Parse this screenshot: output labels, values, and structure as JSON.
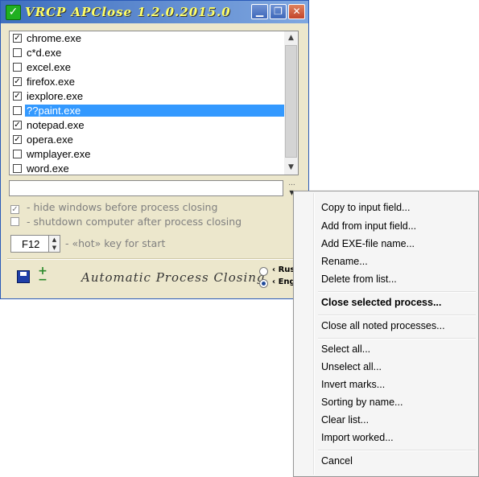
{
  "window": {
    "title": "VRCP APClose 1.2.0.2015.0",
    "buttons": {
      "minimize": "▁",
      "restore": "❐",
      "close": "✕"
    }
  },
  "process_list": [
    {
      "name": "chrome.exe",
      "checked": true,
      "selected": false
    },
    {
      "name": "c*d.exe",
      "checked": false,
      "selected": false
    },
    {
      "name": "excel.exe",
      "checked": false,
      "selected": false
    },
    {
      "name": "firefox.exe",
      "checked": true,
      "selected": false
    },
    {
      "name": "iexplore.exe",
      "checked": true,
      "selected": false
    },
    {
      "name": "??paint.exe",
      "checked": false,
      "selected": true
    },
    {
      "name": "notepad.exe",
      "checked": true,
      "selected": false
    },
    {
      "name": "opera.exe",
      "checked": true,
      "selected": false
    },
    {
      "name": "wmplayer.exe",
      "checked": false,
      "selected": false
    },
    {
      "name": "word.exe",
      "checked": false,
      "selected": false
    }
  ],
  "input": {
    "value": "",
    "dots": "...",
    "arrow": "▼"
  },
  "options": {
    "hide_windows": {
      "label": " - hide windows before process closing",
      "checked": true
    },
    "shutdown": {
      "label": " - shutdown computer after process closing",
      "checked": false
    }
  },
  "hotkey": {
    "value": "F12",
    "label": " - «hot» key for start"
  },
  "brand": "Automatic Process Closing",
  "language": {
    "options": [
      {
        "label": "‹ Rus",
        "selected": false
      },
      {
        "label": "‹ Eng",
        "selected": true
      }
    ]
  },
  "icons": {
    "save": "floppy-disk-icon",
    "add": "plus-minus-icon"
  },
  "context_menu": {
    "items": [
      {
        "label": "Copy to input field...",
        "bold": false
      },
      {
        "label": "Add from input field...",
        "bold": false
      },
      {
        "label": "Add EXE-file name...",
        "bold": false
      },
      {
        "label": "Rename...",
        "bold": false
      },
      {
        "label": "Delete from list...",
        "bold": false
      },
      {
        "label": "Close selected process...",
        "bold": true
      },
      {
        "label": "Close all noted processes...",
        "bold": false
      },
      {
        "label": "Select all...",
        "bold": false
      },
      {
        "label": "Unselect all...",
        "bold": false
      },
      {
        "label": "Invert marks...",
        "bold": false
      },
      {
        "label": "Sorting by name...",
        "bold": false
      },
      {
        "label": "Clear list...",
        "bold": false
      },
      {
        "label": "Import worked...",
        "bold": false
      },
      {
        "label": "Cancel",
        "bold": false
      }
    ]
  },
  "colors": {
    "titlebar": "#3f6fbf",
    "selection": "#3399ff",
    "background": "#ece7cc"
  }
}
